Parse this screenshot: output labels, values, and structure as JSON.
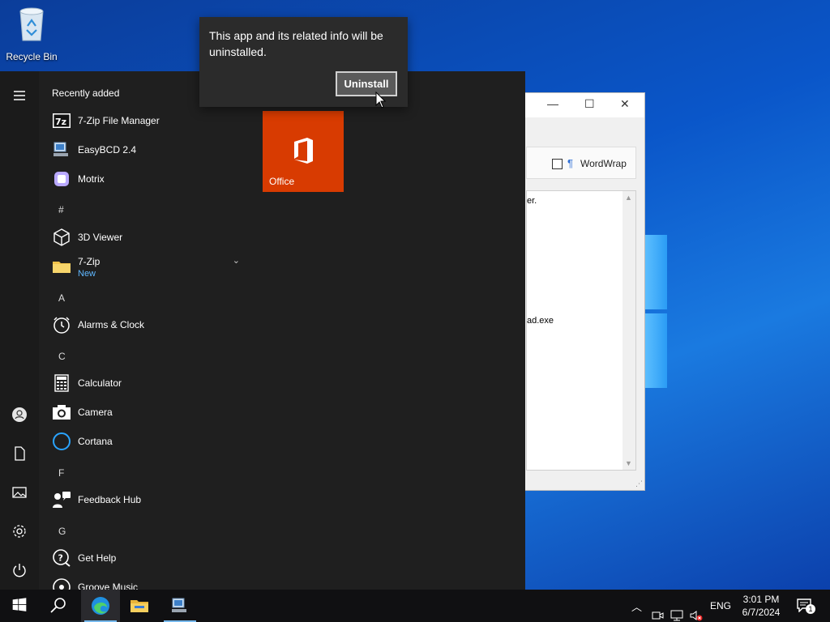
{
  "desktop": {
    "recycle_bin_label": "Recycle Bin"
  },
  "background_window": {
    "minimize": "—",
    "maximize": "☐",
    "close": "✕",
    "wordwrap_label": "WordWrap",
    "text_line_1": "er.",
    "text_line_2": "ad.exe"
  },
  "start_menu": {
    "section_header": "Recently added",
    "recent": [
      {
        "name": "7-Zip File Manager",
        "icon": "7zip-icon"
      },
      {
        "name": "EasyBCD 2.4",
        "icon": "easybcd-icon"
      },
      {
        "name": "Motrix",
        "icon": "motrix-icon"
      }
    ],
    "letters": {
      "hash": "#",
      "a": "A",
      "c": "C",
      "f": "F",
      "g": "G"
    },
    "apps": {
      "viewer3d": "3D Viewer",
      "zip_folder": "7-Zip",
      "zip_folder_badge": "New",
      "alarms": "Alarms & Clock",
      "calculator": "Calculator",
      "camera": "Camera",
      "cortana": "Cortana",
      "feedback": "Feedback Hub",
      "gethelp": "Get Help",
      "groove": "Groove Music"
    },
    "tile_label": "Office",
    "tile_color": "#d83b01"
  },
  "flyout": {
    "message": "This app and its related info will be uninstalled.",
    "button": "Uninstall"
  },
  "taskbar": {
    "language": "ENG",
    "time": "3:01 PM",
    "date": "6/7/2024",
    "notifications": "1",
    "accent": "#76b9ed"
  }
}
